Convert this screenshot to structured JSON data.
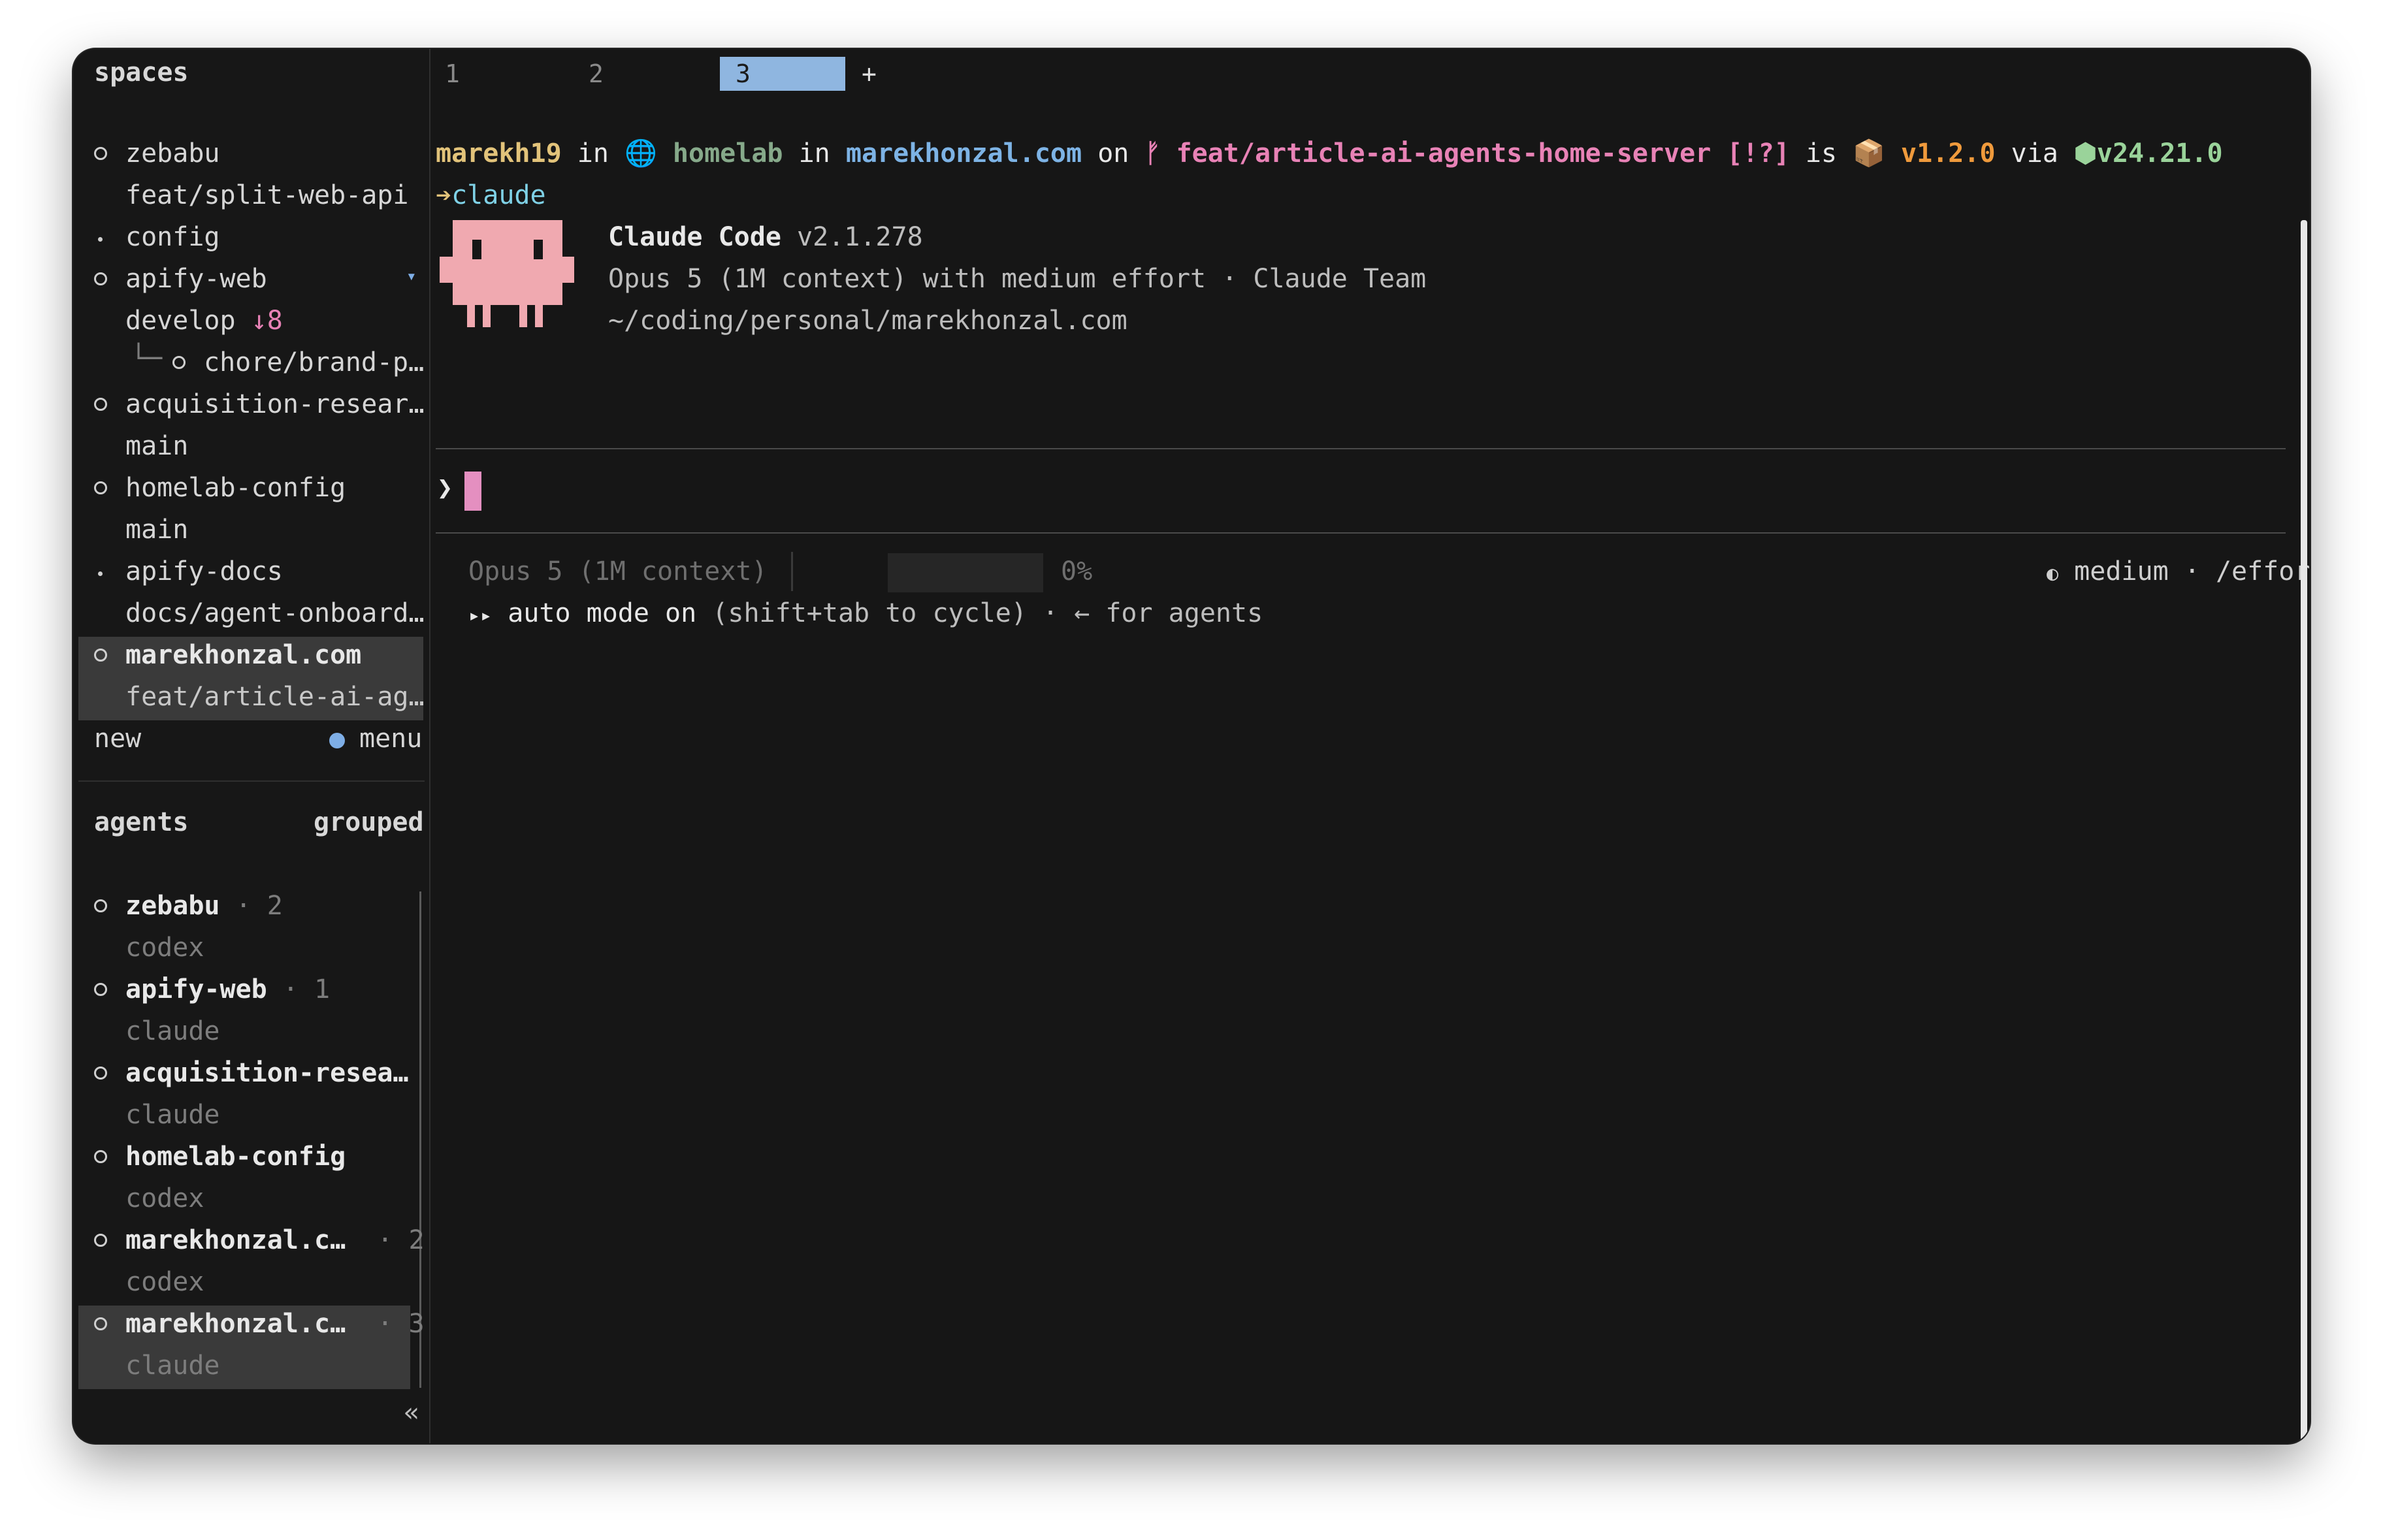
{
  "sidebar": {
    "spaces_header": "spaces",
    "spaces": [
      {
        "name": "zebabu",
        "branch": "feat/split-web-api",
        "marker": "circle"
      },
      {
        "name": "config",
        "branch": "",
        "marker": "dot"
      },
      {
        "name": "apify-web",
        "branch": "develop",
        "ahead": "↓8",
        "caret": "▾",
        "marker": "circle",
        "child": {
          "tree": "└─",
          "name": "chore/brand-p…"
        }
      },
      {
        "name": "acquisition-resear…",
        "branch": "main",
        "marker": "circle"
      },
      {
        "name": "homelab-config",
        "branch": "main",
        "marker": "circle"
      },
      {
        "name": "apify-docs",
        "branch": "docs/agent-onboard…",
        "marker": "dot"
      },
      {
        "name": "marekhonzal.com",
        "branch": "feat/article-ai-ag…",
        "marker": "circle",
        "selected": true
      }
    ],
    "new_label": "new",
    "menu_label": "menu",
    "agents_header": "agents",
    "grouped_label": "grouped",
    "agents": [
      {
        "name": "zebabu",
        "sep": "·",
        "count": "2",
        "tool": "codex"
      },
      {
        "name": "apify-web",
        "sep": "·",
        "count": "1",
        "tool": "claude"
      },
      {
        "name": "acquisition-resea…",
        "sep": "",
        "count": "",
        "tool": "claude"
      },
      {
        "name": "homelab-config",
        "sep": "",
        "count": "",
        "tool": "codex"
      },
      {
        "name": "marekhonzal.c…",
        "sep": "·",
        "count": "2",
        "tool": "codex"
      },
      {
        "name": "marekhonzal.c…",
        "sep": "·",
        "count": "3",
        "tool": "claude",
        "selected": true
      }
    ],
    "collapse_label": "«"
  },
  "tabs": [
    "1",
    "2",
    "3"
  ],
  "tab_add": "+",
  "prompt": {
    "user": "marekh19",
    "in1": "in",
    "host": "homelab",
    "in2": "in",
    "dir": "marekhonzal.com",
    "on": "on",
    "branch": "feat/article-ai-agents-home-server",
    "status": "[!?]",
    "is": "is",
    "version": "v1.2.0",
    "via": "via",
    "node": "v24.21.0",
    "command": "claude"
  },
  "claude": {
    "title": "Claude Code",
    "version": "v2.1.278",
    "model_line": "Opus 5 (1M context) with medium effort · Claude Team",
    "path": "~/coding/personal/marekhonzal.com"
  },
  "input_prompt": "❯",
  "status": {
    "model": "Opus 5 (1M context)",
    "context_fraction": 0,
    "context_pct": "0%",
    "effort": "medium",
    "effort_sep": "·",
    "effort_cmd": "/effort",
    "auto_mode": "auto mode on",
    "auto_mode_hint": "(shift+tab to cycle) · ← for agents",
    "auto_icon": "▸▸"
  },
  "colors": {
    "background": "#161616",
    "tab_active": "#8fb6e0",
    "user": "#e2c37a",
    "branch": "#e882b6",
    "dir": "#7db3e5",
    "version": "#ef9a3c",
    "node": "#9ad39a",
    "mascot": "#f0a9b0",
    "cursor": "#e48fc0",
    "menu_dot": "#7eaee6"
  }
}
